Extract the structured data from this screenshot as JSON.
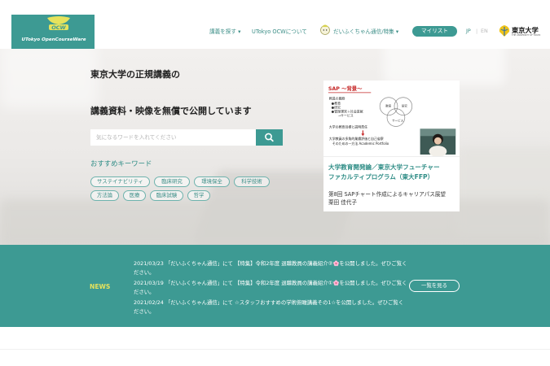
{
  "brand": {
    "logo_text": "UTokyo OpenCourseWare",
    "university_name": "東京大学",
    "university_sub": "THE UNIVERSITY OF TOKYO"
  },
  "nav": {
    "search": "講義を探す ▾",
    "about": "UTokyo OCWについて",
    "daifuku": "だいふくちゃん通信/特集 ▾",
    "mylist": "マイリスト",
    "lang_jp": "JP",
    "lang_sep": "|",
    "lang_en": "EN"
  },
  "hero": {
    "title_line1": "東京大学の正規講義の",
    "title_line2": "講義資料・映像を無償で公開しています",
    "search_placeholder": "気になるワードを入れてください",
    "keywords_heading": "おすすめキーワード",
    "keywords": [
      "サステイナビリティ",
      "臨床研究",
      "環境保全",
      "科学技術",
      "方法論",
      "医療",
      "臨床試験",
      "哲学"
    ]
  },
  "feature_card": {
    "slide_heading": "SAP 〜背景〜",
    "slide_lines": [
      "教員の職務",
      "●教育",
      "●研究",
      "●管理運営＋社会貢献",
      "→サービス",
      "大学の教育目標と説明責任",
      "大学教員の多角的業績評価と自己省察",
      "そのための一方法 Academic Portfolio"
    ],
    "venn_labels": [
      "教育",
      "研究",
      "サービス"
    ],
    "title_line1": "大学教育開発論／東京大学フューチャー",
    "title_line2": "ファカルティプログラム（東大FFP）",
    "subtitle_line1": "第8回 SAPチャート作成によるキャリアパス展望",
    "subtitle_line2": "栗田 佳代子"
  },
  "news": {
    "label": "NEWS",
    "more_label": "一覧を見る",
    "items": [
      {
        "text": "2021/03/23 「だいふくちゃん通信」にて 【特集】令和2年度 退職教員の講義紹介②🌸を公開しました。ぜひご覧ください。"
      },
      {
        "text": "2021/03/19 「だいふくちゃん通信」にて 【特集】令和2年度 退職教員の講義紹介①🌸を公開しました。ぜひご覧ください。"
      },
      {
        "text": "2021/02/24 「だいふくちゃん通信」にて ☆スタッフおすすめの学術俯瞰講義その1☆を公開しました。ぜひご覧ください。"
      }
    ]
  },
  "colors": {
    "accent": "#3d9a93",
    "news_label": "#e6e35c",
    "slide_red": "#c62828"
  }
}
